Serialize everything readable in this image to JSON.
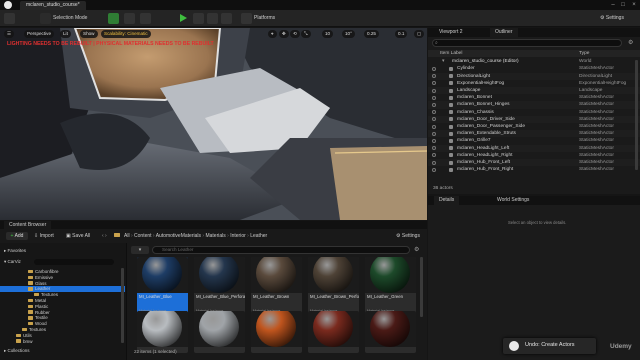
{
  "window": {
    "tab_title": "mclaren_studio_course*",
    "settings_label": "Settings"
  },
  "toolbar": {
    "selection_mode": "Selection Mode",
    "platforms": "Platforms"
  },
  "viewport": {
    "perspective": "Perspective",
    "lit": "Lit",
    "show": "Show",
    "scalability": "Scalability: Cinematic",
    "lighting_warning": "LIGHTING NEEDS TO BE REBUILT | PHYSICAL MATERIALS NEEDS TO BE REBUILT",
    "grid_snap": "10",
    "rot_snap": "10°",
    "scale_snap": "0.25",
    "camera_speed": "0.1"
  },
  "outliner": {
    "viewport_tab": "Viewport 2",
    "outliner_tab": "Outliner",
    "search_placeholder": "Search...",
    "col_item_label": "Item Label",
    "col_type": "Type",
    "root_label": "mclaren_studio_course (Editor)",
    "root_type": "World",
    "rows": [
      {
        "name": "Cylinder",
        "type": "StaticMeshActor"
      },
      {
        "name": "DirectionalLight",
        "type": "DirectionalLight"
      },
      {
        "name": "ExponentialHeightFog",
        "type": "ExponentialHeightFog"
      },
      {
        "name": "Landscape",
        "type": "Landscape"
      },
      {
        "name": "mclaren_Bonnet",
        "type": "StaticMeshActor"
      },
      {
        "name": "mclaren_Bonnet_Hinges",
        "type": "StaticMeshActor"
      },
      {
        "name": "mclaren_Chassis",
        "type": "StaticMeshActor"
      },
      {
        "name": "mclaren_Door_Driver_Side",
        "type": "StaticMeshActor"
      },
      {
        "name": "mclaren_Door_Passenger_Side",
        "type": "StaticMeshActor"
      },
      {
        "name": "mclaren_Extendable_Struts",
        "type": "StaticMeshActor"
      },
      {
        "name": "mclaren_Grille7",
        "type": "StaticMeshActor"
      },
      {
        "name": "mclaren_HeadLight_Left",
        "type": "StaticMeshActor"
      },
      {
        "name": "mclaren_HeadLight_Right",
        "type": "StaticMeshActor"
      },
      {
        "name": "mclaren_Hub_Front_Left",
        "type": "StaticMeshActor"
      },
      {
        "name": "mclaren_Hub_Front_Right",
        "type": "StaticMeshActor"
      }
    ],
    "actor_count": "36 actors"
  },
  "details": {
    "details_tab": "Details",
    "world_settings_tab": "World Settings",
    "empty_hint": "Select an object to view details."
  },
  "content_browser": {
    "tab_label": "Content Browser",
    "add_label": "Add",
    "import_label": "Import",
    "save_all_label": "Save All",
    "settings_label": "Settings",
    "path": [
      "All",
      "Content",
      "AutomotiveMaterials",
      "Materials",
      "Interior",
      "Leather"
    ],
    "search_placeholder": "Search Leather",
    "favorites_label": "Favorites",
    "project_label": "CarViz",
    "tree": [
      {
        "name": "Carbonfibre",
        "depth": 3,
        "selected": false
      },
      {
        "name": "Emissive",
        "depth": 3,
        "selected": false
      },
      {
        "name": "Glass",
        "depth": 3,
        "selected": false
      },
      {
        "name": "Leather",
        "depth": 3,
        "selected": true
      },
      {
        "name": "Textures",
        "depth": 4,
        "selected": false
      },
      {
        "name": "Metal",
        "depth": 3,
        "selected": false
      },
      {
        "name": "Plastic",
        "depth": 3,
        "selected": false
      },
      {
        "name": "Rubber",
        "depth": 3,
        "selected": false
      },
      {
        "name": "Textile",
        "depth": 3,
        "selected": false
      },
      {
        "name": "Wood",
        "depth": 3,
        "selected": false
      },
      {
        "name": "Textures",
        "depth": 2,
        "selected": false
      },
      {
        "name": "Utils",
        "depth": 1,
        "selected": false
      },
      {
        "name": "bmw",
        "depth": 1,
        "selected": false
      }
    ],
    "collections_label": "Collections",
    "assets": [
      {
        "name": "MI_Leather_Blue",
        "type": "Material Instance",
        "selected": true,
        "color": "#1e3d66"
      },
      {
        "name": "MI_Leather_Blue_Perforated",
        "type": "Material Instance",
        "selected": false,
        "color": "#24364d"
      },
      {
        "name": "MI_Leather_Brown",
        "type": "Material Instance",
        "selected": false,
        "color": "#5a4a3c"
      },
      {
        "name": "MI_Leather_Brown_Perforated",
        "type": "Material Instance",
        "selected": false,
        "color": "#4e4236"
      },
      {
        "name": "MI_Leather_Green",
        "type": "Material Instance",
        "selected": false,
        "color": "#1d4a2a"
      },
      {
        "name": "",
        "type": "",
        "selected": false,
        "color": "#b8bcc0"
      },
      {
        "name": "",
        "type": "",
        "selected": false,
        "color": "#a0a4a8"
      },
      {
        "name": "",
        "type": "",
        "selected": false,
        "color": "#c0551e"
      },
      {
        "name": "",
        "type": "",
        "selected": false,
        "color": "#7a2a1e"
      },
      {
        "name": "",
        "type": "",
        "selected": false,
        "color": "#4a1a16"
      }
    ],
    "status": "22 items (1 selected)"
  },
  "notification": {
    "text": "Undo: Create Actors"
  },
  "watermark": "Udemy",
  "colors": {
    "accent_blue": "#1d6fd8",
    "folder": "#c9a24c",
    "warning_red": "#e03030",
    "play_green": "#3fbf3f"
  }
}
